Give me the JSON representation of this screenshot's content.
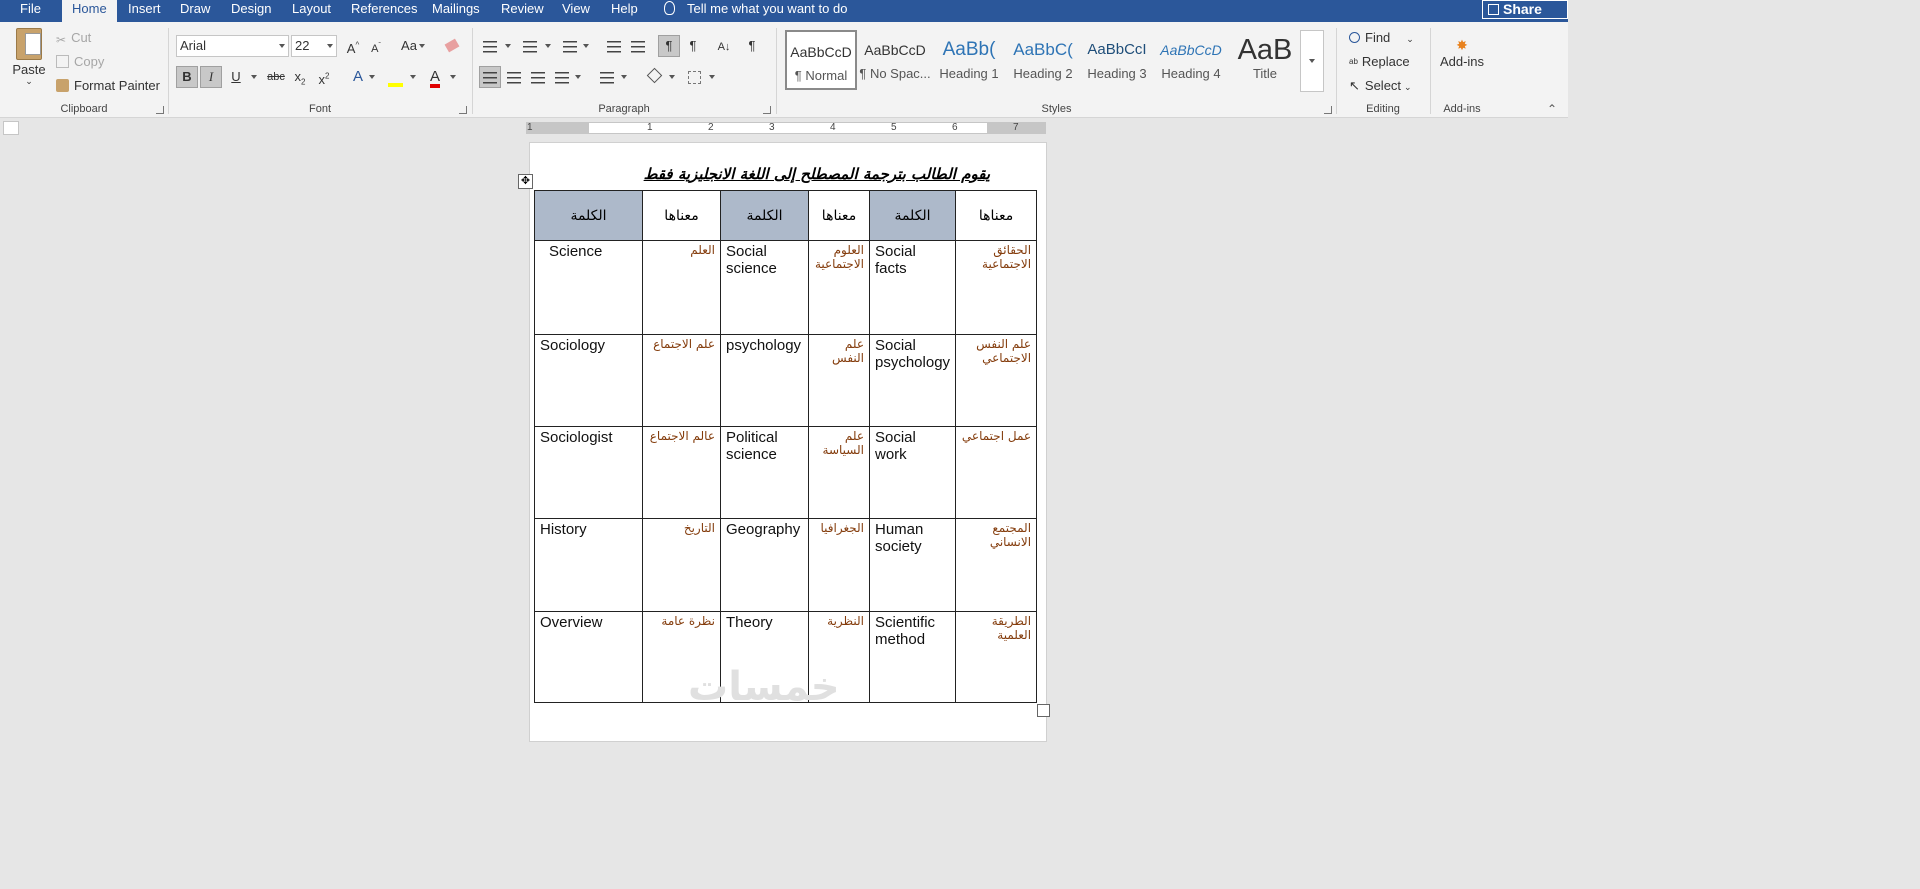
{
  "tabs": [
    {
      "label": "File",
      "active": false
    },
    {
      "label": "Home",
      "active": true
    },
    {
      "label": "Insert",
      "active": false
    },
    {
      "label": "Draw",
      "active": false
    },
    {
      "label": "Design",
      "active": false
    },
    {
      "label": "Layout",
      "active": false
    },
    {
      "label": "References",
      "active": false
    },
    {
      "label": "Mailings",
      "active": false
    },
    {
      "label": "Review",
      "active": false
    },
    {
      "label": "View",
      "active": false
    },
    {
      "label": "Help",
      "active": false
    }
  ],
  "tell_me": "Tell me what you want to do",
  "share_label": "Share",
  "clipboard": {
    "paste": "Paste",
    "cut": "Cut",
    "copy": "Copy",
    "format_painter": "Format Painter",
    "label": "Clipboard"
  },
  "font": {
    "name": "Arial",
    "size": "22",
    "change_case": "Aa",
    "label": "Font"
  },
  "paragraph": {
    "label": "Paragraph"
  },
  "styles": {
    "items": [
      {
        "sample": "AaBbCcD",
        "name": "¶ Normal"
      },
      {
        "sample": "AaBbCcD",
        "name": "¶ No Spac..."
      },
      {
        "sample": "AaBb(",
        "name": "Heading 1"
      },
      {
        "sample": "AaBbC(",
        "name": "Heading 2"
      },
      {
        "sample": "AaBbCcI",
        "name": "Heading 3"
      },
      {
        "sample": "AaBbCcD",
        "name": "Heading 4"
      },
      {
        "sample": "AaB",
        "name": "Title"
      }
    ],
    "label": "Styles"
  },
  "editing": {
    "find": "Find",
    "replace": "Replace",
    "select": "Select",
    "label": "Editing"
  },
  "addins": {
    "button": "Add-ins",
    "label": "Add-ins"
  },
  "ruler": {
    "numbers": [
      "1",
      "1",
      "2",
      "3",
      "4",
      "5",
      "6",
      "7"
    ]
  },
  "document": {
    "title": "يقوم الطالب بترجمة المصطلح إلى اللغة الانجليزية فقط",
    "header": [
      "الكلمة",
      "معناها",
      "الكلمة",
      "معناها",
      "الكلمة",
      "معناها"
    ],
    "rows": [
      [
        "Science",
        "العلم",
        "Social science",
        "العلوم الاجتماعية",
        "Social facts",
        "الحقائق الاجتماعية"
      ],
      [
        "Sociology",
        "علم الاجتماع",
        "psychology",
        "علم النفس",
        "Social psychology",
        "علم النفس الاجتماعي"
      ],
      [
        "Sociologist",
        "عالم الاجتماع",
        "Political science",
        "علم السياسة",
        "Social work",
        "عمل اجتماعي"
      ],
      [
        "History",
        "التاريخ",
        "Geography",
        "الجغرافيا",
        "Human society",
        "المجتمع الانساني"
      ],
      [
        "Overview",
        "نظرة عامة",
        "Theory",
        "النظرية",
        "Scientific method",
        "الطريقة العلمية"
      ]
    ],
    "watermark": "خمسات"
  }
}
